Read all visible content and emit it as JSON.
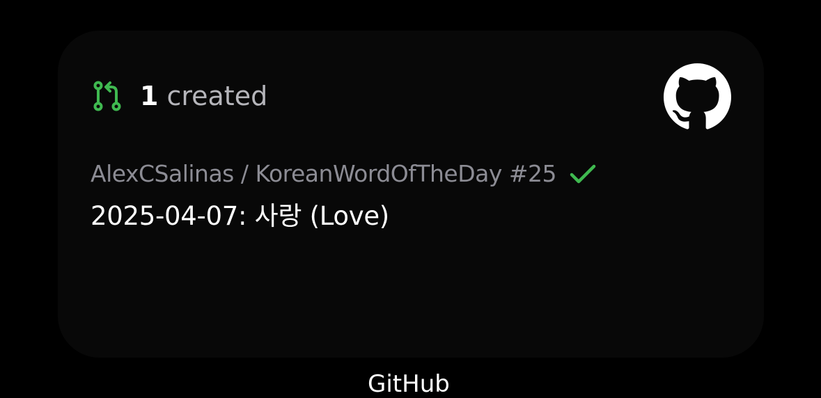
{
  "widget": {
    "created_count": "1",
    "created_label": "created",
    "repo_line": "AlexCSalinas / KoreanWordOfTheDay #25",
    "pr_title": "2025-04-07: 사랑 (Love)",
    "status": "merged",
    "icons": {
      "pull_request": "pull-request-icon",
      "github": "github-logo-icon",
      "check": "checkmark-icon"
    },
    "colors": {
      "accent_green": "#3fb950",
      "background": "#080808"
    }
  },
  "footer": {
    "label": "GitHub"
  }
}
